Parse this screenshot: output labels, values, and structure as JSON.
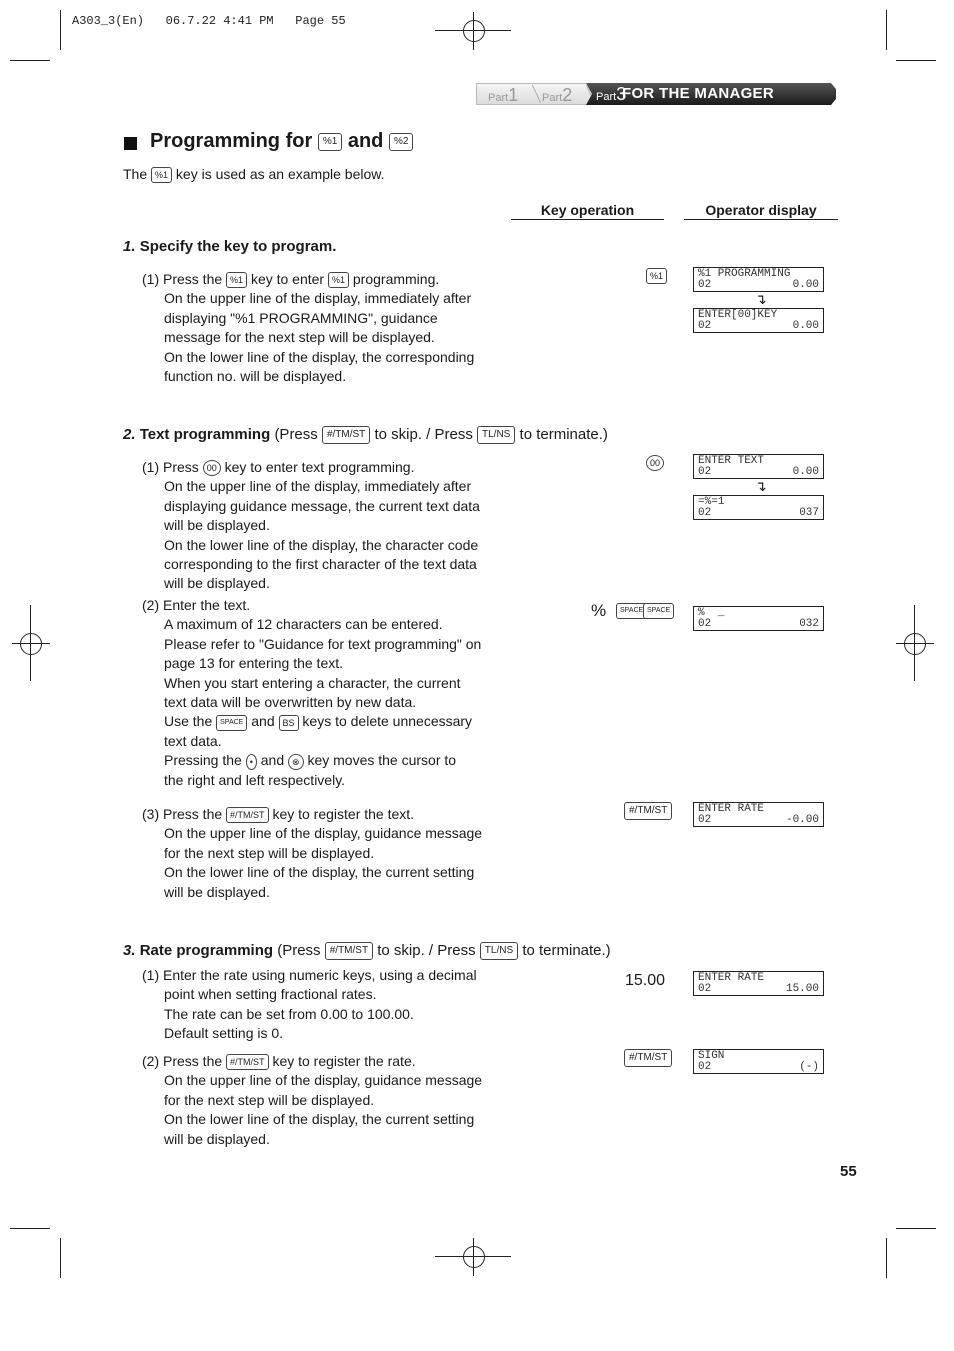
{
  "print_header": "A303_3(En)   06.7.22 4:41 PM   Page 55",
  "banner": {
    "parts": [
      {
        "prefix": "Part",
        "num": "1"
      },
      {
        "prefix": "Part",
        "num": "2"
      },
      {
        "prefix": "Part",
        "num": "3"
      }
    ],
    "active_title": "FOR THE MANAGER"
  },
  "heading": {
    "text1": "Programming for",
    "key1": "%1",
    "and": "and",
    "key2": "%2"
  },
  "intro": {
    "pre": "The",
    "key": "%1",
    "post": "key is used as an example below."
  },
  "columns": {
    "key_operation": "Key operation",
    "operator_display": "Operator display"
  },
  "steps": [
    {
      "num": "1.",
      "title": "Specify the key to program.",
      "items": [
        {
          "first_pre": "(1) Press the",
          "key1": "%1",
          "mid": "key to enter",
          "key2": "%1",
          "post": "programming.",
          "lines": [
            "On the upper line of the display, immediately after",
            "displaying \"%1 PROGRAMMING\", guidance",
            "message for the next step will be displayed.",
            "On the lower line of the display, the corresponding",
            "function no. will be displayed."
          ],
          "key_op": "%1",
          "displays": [
            {
              "line1": "%1 PROGRAMMING",
              "code": "02",
              "value": "0.00"
            },
            {
              "line1": "ENTER[00]KEY",
              "code": "02",
              "value": "0.00"
            }
          ]
        }
      ]
    },
    {
      "num": "2.",
      "title": "Text programming",
      "sub_pre": "(Press",
      "skip_key": "#/TM/ST",
      "sub_mid": "to skip. / Press",
      "term_key": "TL/NS",
      "sub_post": "to terminate.)",
      "items": [
        {
          "first_pre": "(1) Press",
          "key1": "00",
          "post": "key to enter text programming.",
          "lines": [
            "On the upper line of the display, immediately after",
            "displaying guidance message, the current text data",
            "will be displayed.",
            "On the lower line of the display, the character code",
            "corresponding to the first character of the text data",
            "will be displayed."
          ],
          "key_op": "00",
          "displays": [
            {
              "line1": "ENTER TEXT",
              "code": "02",
              "value": "0.00"
            },
            {
              "line1": "=%=1",
              "code": "02",
              "value": "037"
            }
          ]
        },
        {
          "first": "(2) Enter the text.",
          "lines": [
            "A maximum of 12 characters can be entered.",
            "Please refer to \"Guidance for text programming\" on",
            "page 13 for entering the text.",
            "When you start entering a character, the current",
            "text data will be overwritten by new data."
          ],
          "use_pre": "Use the",
          "use_key1": "SPACE",
          "use_and": "and",
          "use_key2": "BS",
          "use_post": "keys to delete unnecessary",
          "use_line2": "text data.",
          "press_pre": "Pressing the",
          "press_key1": "•",
          "press_and": "and",
          "press_key2": "⊗",
          "press_post": "key moves the cursor to",
          "press_line2": "the right and left respectively.",
          "key_op_text": "%",
          "key_op_keys": [
            "SPACE",
            "SPACE"
          ],
          "displays": [
            {
              "line1": "%  _",
              "code": "02",
              "value": "032"
            }
          ]
        },
        {
          "first_pre": "(3) Press the",
          "key1": "#/TM/ST",
          "post": "key to register the text.",
          "lines": [
            "On the upper line of the display, guidance message",
            "for the next step will be displayed.",
            "On the lower line of the display, the current setting",
            "will be displayed."
          ],
          "key_op": "#/TM/ST",
          "displays": [
            {
              "line1": "ENTER RATE",
              "code": "02",
              "value": "-0.00"
            }
          ]
        }
      ]
    },
    {
      "num": "3.",
      "title": "Rate programming",
      "sub_pre": "(Press",
      "skip_key": "#/TM/ST",
      "sub_mid": "to skip. / Press",
      "term_key": "TL/NS",
      "sub_post": "to terminate.)",
      "items": [
        {
          "first": "(1) Enter the rate using numeric keys, using a decimal",
          "lines": [
            "point when setting fractional rates.",
            "The rate can be set from 0.00 to 100.00.",
            "Default setting is 0."
          ],
          "key_op_text": "15.00",
          "displays": [
            {
              "line1": "ENTER RATE",
              "code": "02",
              "value": "15.00"
            }
          ]
        },
        {
          "first_pre": "(2) Press the",
          "key1": "#/TM/ST",
          "post": "key to register the rate.",
          "lines": [
            "On the upper line of the display, guidance message",
            "for the next step will be displayed.",
            "On the lower line of the display, the current setting",
            "will be displayed."
          ],
          "key_op": "#/TM/ST",
          "displays": [
            {
              "line1": "SIGN",
              "code": "02",
              "value": "(-)"
            }
          ]
        }
      ]
    }
  ],
  "page_number": "55"
}
